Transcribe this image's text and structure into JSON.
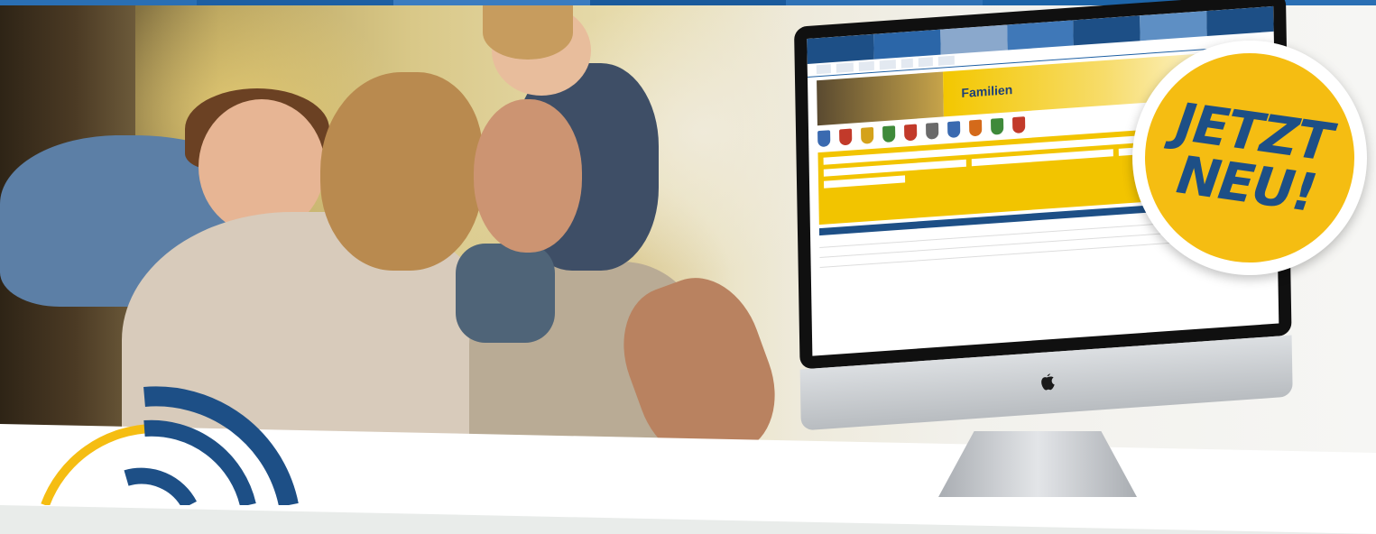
{
  "colors": {
    "brand_blue": "#1d4f86",
    "brand_yellow": "#f5bd12",
    "top_bar": [
      "#2a6fb4",
      "#1d5fa3",
      "#3b7cc0",
      "#1a5a9c",
      "#2f72b6",
      "#1d64a8",
      "#2a6fb4"
    ]
  },
  "photo": {
    "subject": "family-outdoors"
  },
  "monitor": {
    "screen": {
      "brand": "Familien",
      "header_colors": [
        "#1d4f86",
        "#2b66a8",
        "#8aa8cc",
        "#3f78b8",
        "#1d4f86",
        "#5e8fc4",
        "#1d4f86"
      ]
    },
    "crest_colors": [
      "#3a6ab0",
      "#c23a2a",
      "#d4a21a",
      "#3f8a3a",
      "#c23a2a",
      "#6a6a6a",
      "#3a6ab0",
      "#d46a1a",
      "#3f8a3a",
      "#c23a2a"
    ]
  },
  "badge": {
    "line1": "JETZT",
    "line2": "NEU!"
  },
  "logo": {
    "icon": "signal-wave-icon"
  }
}
